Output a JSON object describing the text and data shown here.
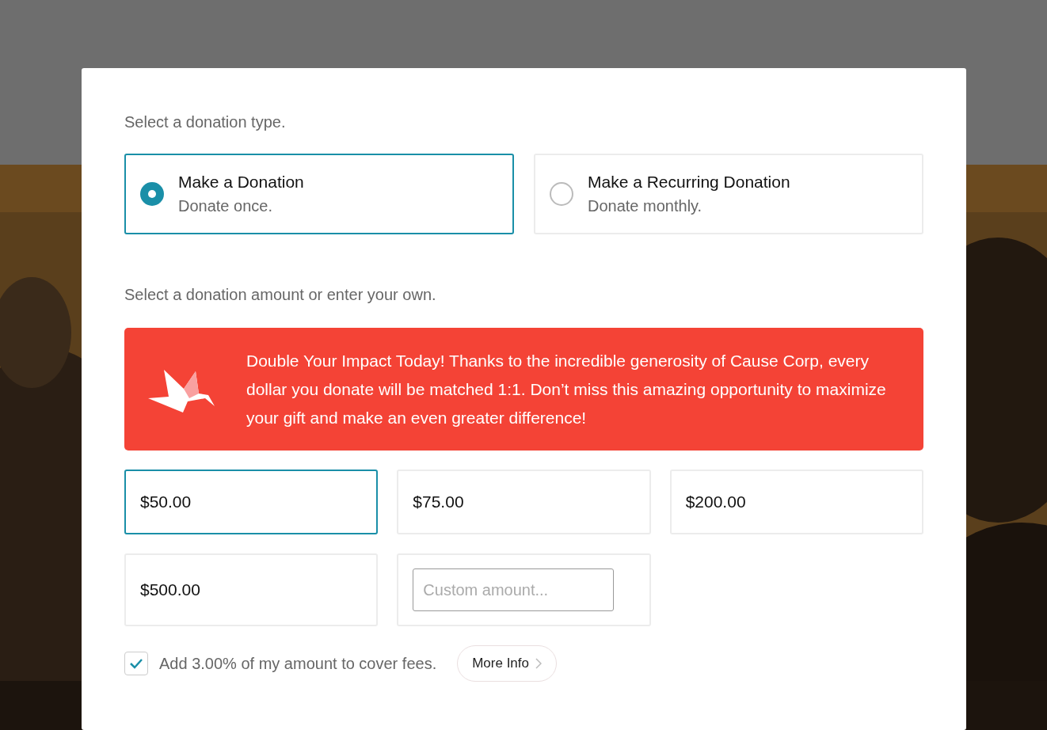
{
  "donation_type": {
    "prompt": "Select a donation type.",
    "options": [
      {
        "title": "Make a Donation",
        "subtitle": "Donate once.",
        "selected": true
      },
      {
        "title": "Make a Recurring Donation",
        "subtitle": "Donate monthly.",
        "selected": false
      }
    ]
  },
  "amount": {
    "prompt": "Select a donation amount or enter your own.",
    "banner": "Double Your Impact Today! Thanks to the incredible generosity of Cause Corp, every dollar you donate will be matched 1:1. Don’t miss this amazing opportunity to maximize your gift and make an even greater difference!",
    "options": [
      {
        "label": "$50.00",
        "selected": true
      },
      {
        "label": "$75.00",
        "selected": false
      },
      {
        "label": "$200.00",
        "selected": false
      },
      {
        "label": "$500.00",
        "selected": false
      }
    ],
    "custom": {
      "placeholder": "Custom amount..."
    }
  },
  "fees": {
    "label": "Add 3.00% of my amount to cover fees.",
    "checked": true,
    "more_info": "More Info"
  }
}
